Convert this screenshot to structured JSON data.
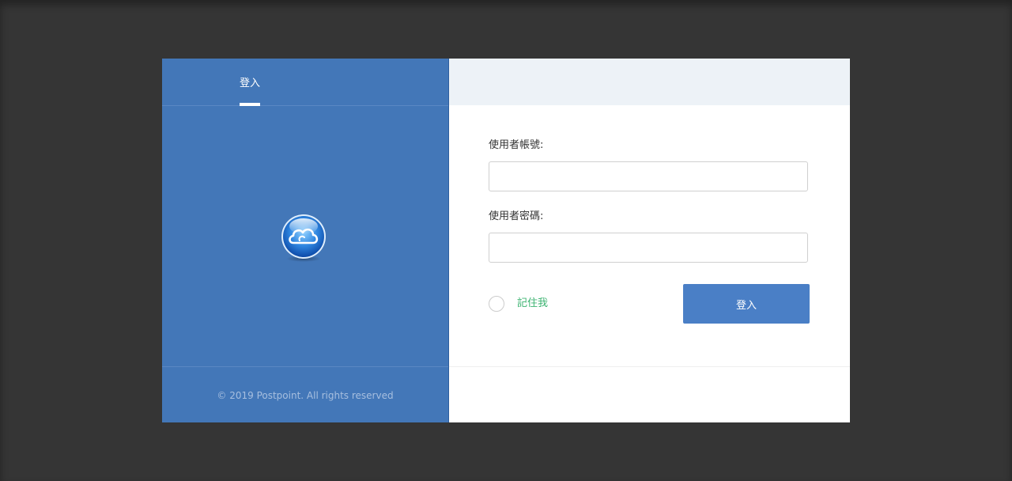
{
  "tabs": {
    "login_label": "登入"
  },
  "form": {
    "username_label": "使用者帳號:",
    "username_value": "",
    "password_label": "使用者密碼:",
    "password_value": "",
    "remember_label": "記住我",
    "submit_label": "登入"
  },
  "footer": {
    "copyright": "© 2019 Postpoint. All rights reserved"
  },
  "icons": {
    "logo": "cloud-logo-icon"
  },
  "colors": {
    "panel_blue": "#4377b8",
    "button_blue": "#4a7fc6",
    "remember_green": "#3cb371",
    "backdrop": "#353535"
  }
}
